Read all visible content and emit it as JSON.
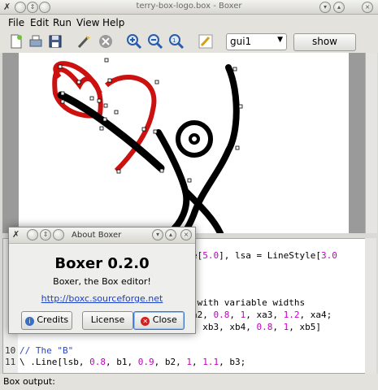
{
  "window": {
    "title": "terry-box-logo.box - Boxer"
  },
  "menu": {
    "file": "File",
    "edit": "Edit",
    "run": "Run",
    "view": "View",
    "help": "Help"
  },
  "toolbar": {
    "icons": [
      "new-file-icon",
      "print-icon",
      "save-icon",
      "run-icon",
      "stop-icon",
      "zoom-in-icon",
      "zoom-out-icon",
      "zoom-fit-icon",
      "edit-pencil-icon"
    ],
    "view_select": "gui1",
    "show_label": "show"
  },
  "editor": {
    "lines": [
      {
        "n": "",
        "parts": [
          {
            "t": "e[",
            "c": ""
          },
          {
            "t": "5.0",
            "c": "num"
          },
          {
            "t": "], lsa = LineStyle[",
            "c": ""
          },
          {
            "t": "3.0",
            "c": "num"
          }
        ]
      },
      {
        "n": "",
        "parts": []
      },
      {
        "n": "",
        "parts": []
      },
      {
        "n": "",
        "parts": []
      },
      {
        "n": "",
        "parts": [
          {
            "t": " with variable widths",
            "c": ""
          }
        ]
      },
      {
        "n": "",
        "parts": [
          {
            "t": "a2, ",
            "c": ""
          },
          {
            "t": "0.8",
            "c": "num"
          },
          {
            "t": ", ",
            "c": ""
          },
          {
            "t": "1",
            "c": "num"
          },
          {
            "t": ", xa3, ",
            "c": ""
          },
          {
            "t": "1.2",
            "c": "num"
          },
          {
            "t": ", xa4;",
            "c": ""
          }
        ]
      },
      {
        "n": "",
        "parts": [
          {
            "t": ", xb3, xb4, ",
            "c": ""
          },
          {
            "t": "0.8",
            "c": "num"
          },
          {
            "t": ", ",
            "c": ""
          },
          {
            "t": "1",
            "c": "num"
          },
          {
            "t": ", xb5]",
            "c": ""
          }
        ]
      },
      {
        "n": "",
        "parts": []
      },
      {
        "n": "10",
        "parts": [
          {
            "t": "// The \"B\"",
            "c": "cmt"
          }
        ]
      },
      {
        "n": "11",
        "parts": [
          {
            "t": "\\ .Line[lsb, ",
            "c": ""
          },
          {
            "t": "0.8",
            "c": "num"
          },
          {
            "t": ", b1, ",
            "c": ""
          },
          {
            "t": "0.9",
            "c": "num"
          },
          {
            "t": ", b2, ",
            "c": ""
          },
          {
            "t": "1",
            "c": "num"
          },
          {
            "t": ", ",
            "c": ""
          },
          {
            "t": "1.1",
            "c": "num"
          },
          {
            "t": ", b3;",
            "c": ""
          }
        ]
      }
    ]
  },
  "statusbar": {
    "label": "Box output:"
  },
  "about": {
    "title": "About Boxer",
    "name": "Boxer 0.2.0",
    "comment": "Boxer, the Box editor!",
    "website": "http://boxc.sourceforge.net",
    "credits_label": "Credits",
    "license_label": "License",
    "close_label": "Close"
  },
  "colors": {
    "logo_red": "#cc1111",
    "stroke": "#000000",
    "comment": "#2b44c8",
    "number": "#c000c0"
  }
}
